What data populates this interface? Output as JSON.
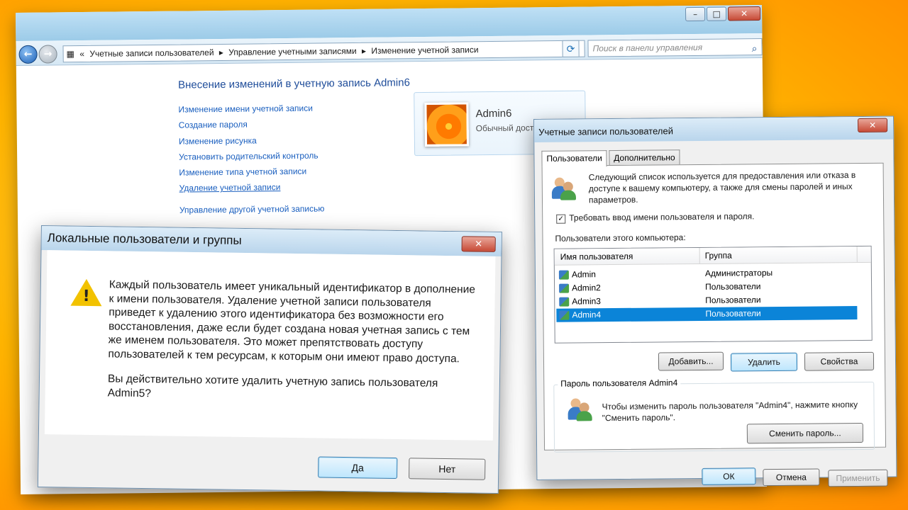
{
  "control_panel": {
    "breadcrumb": [
      "Учетные записи пользователей",
      "Управление учетными записями",
      "Изменение учетной записи"
    ],
    "search_placeholder": "Поиск в панели управления",
    "heading": "Внесение изменений в учетную запись Admin6",
    "links": [
      "Изменение имени учетной записи",
      "Создание пароля",
      "Изменение рисунка",
      "Установить родительский контроль",
      "Изменение типа учетной записи",
      "Удаление учетной записи",
      "Управление другой учетной записью"
    ],
    "user_name": "Admin6",
    "user_role": "Обычный дост"
  },
  "dialog": {
    "title": "Локальные пользователи и группы",
    "message": "Каждый пользователь имеет уникальный идентификатор в дополнение к имени пользователя. Удаление учетной записи пользователя приведет к удалению этого идентификатора без возможности его восстановления, даже если будет создана новая учетная запись с тем же именем пользователя. Это может препятствовать доступу пользователей к тем ресурсам, к которым они имеют право доступа.",
    "question": "Вы действительно хотите удалить учетную запись пользователя Admin5?",
    "yes": "Да",
    "no": "Нет"
  },
  "user_accounts": {
    "title": "Учетные записи пользователей",
    "tabs": [
      "Пользователи",
      "Дополнительно"
    ],
    "intro": "Следующий список используется для предоставления или отказа в доступе к вашему компьютеру, а также для смены паролей и иных параметров.",
    "require_login_label": "Требовать ввод имени пользователя и пароля.",
    "require_login_checked": true,
    "list_caption": "Пользователи этого компьютера:",
    "columns": [
      "Имя пользователя",
      "Группа"
    ],
    "users": [
      {
        "name": "Admin",
        "group": "Администраторы"
      },
      {
        "name": "Admin2",
        "group": "Пользователи"
      },
      {
        "name": "Admin3",
        "group": "Пользователи"
      },
      {
        "name": "Admin4",
        "group": "Пользователи"
      }
    ],
    "selected_user": "Admin4",
    "buttons": {
      "add": "Добавить...",
      "remove": "Удалить",
      "properties": "Свойства"
    },
    "password_group_title": "Пароль пользователя Admin4",
    "password_text": "Чтобы изменить пароль пользователя \"Admin4\", нажмите кнопку \"Сменить пароль\".",
    "change_password": "Сменить пароль...",
    "ok": "ОК",
    "cancel": "Отмена",
    "apply": "Применить"
  },
  "colors": {
    "link": "#1a5fbf",
    "selection": "#0b84d8",
    "background": "#ffb400"
  }
}
